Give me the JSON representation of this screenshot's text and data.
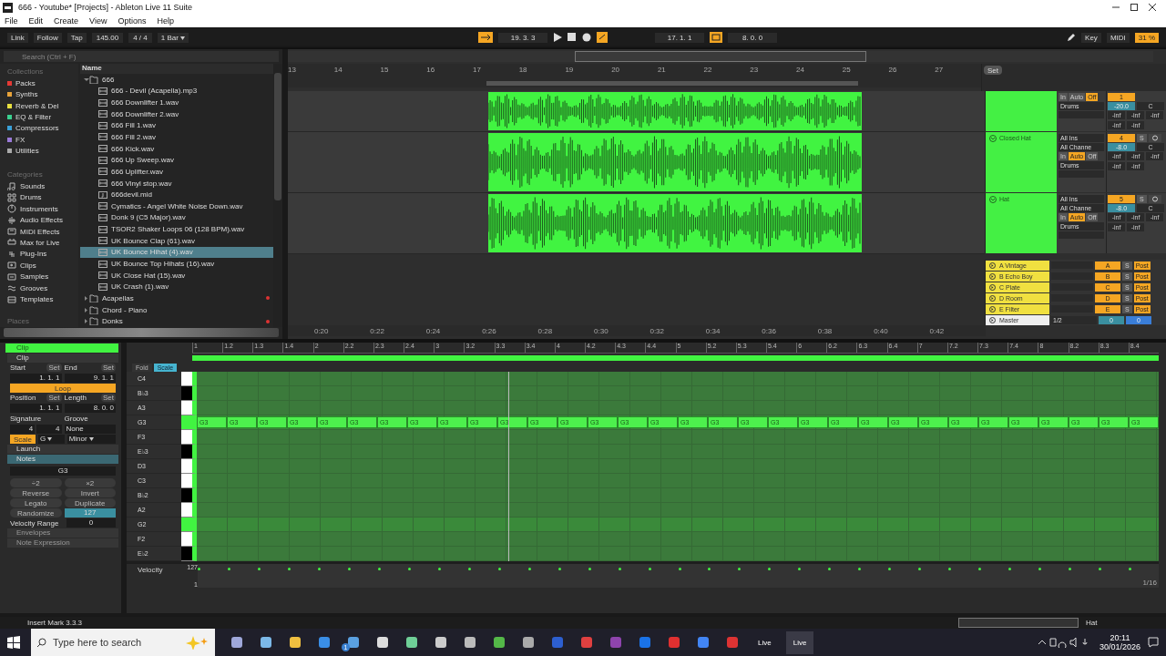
{
  "window": {
    "title": "666 - Youtube*  [Projects] - Ableton Live 11 Suite"
  },
  "menu": [
    "File",
    "Edit",
    "Create",
    "View",
    "Options",
    "Help"
  ],
  "transport": {
    "link": "Link",
    "follow": "Follow",
    "tap": "Tap",
    "tempo": "145.00",
    "signature": "4 / 4",
    "quantize": "1 Bar",
    "position": "19.  3.  3",
    "loop_start": "17.  1.  1",
    "loop_length": "8.  0.  0",
    "key": "Key",
    "midi": "MIDI",
    "cpu": "31 %"
  },
  "browser": {
    "search": {
      "placeholder": "Search (Ctrl + F)"
    },
    "collections_heading": "Collections",
    "collections": [
      {
        "label": "Packs",
        "color": "#e53935"
      },
      {
        "label": "Synths",
        "color": "#e8a33a"
      },
      {
        "label": "Reverb & Del",
        "color": "#e8e040"
      },
      {
        "label": "EQ & Filter",
        "color": "#3ad08f"
      },
      {
        "label": "Compressors",
        "color": "#3aa0d8"
      },
      {
        "label": "FX",
        "color": "#9a7ad8"
      },
      {
        "label": "Utilities",
        "color": "#aaaaaa"
      }
    ],
    "categories_heading": "Categories",
    "categories": [
      {
        "label": "Sounds",
        "kind": "sounds"
      },
      {
        "label": "Drums",
        "kind": "drums"
      },
      {
        "label": "Instruments",
        "kind": "instruments"
      },
      {
        "label": "Audio Effects",
        "kind": "audio"
      },
      {
        "label": "MIDI Effects",
        "kind": "midi"
      },
      {
        "label": "Max for Live",
        "kind": "max"
      },
      {
        "label": "Plug-Ins",
        "kind": "plugins"
      },
      {
        "label": "Clips",
        "kind": "clips"
      },
      {
        "label": "Samples",
        "kind": "samples"
      },
      {
        "label": "Grooves",
        "kind": "grooves"
      },
      {
        "label": "Templates",
        "kind": "templates"
      }
    ],
    "places_heading": "Places",
    "name_heading": "Name",
    "files": [
      {
        "label": "666",
        "kind": "folder",
        "expanded": true,
        "marked": false,
        "selected": false,
        "children": [
          {
            "label": "666 - Devil (Acapella).mp3",
            "kind": "audio",
            "selected": false
          },
          {
            "label": "666 Downlifter 1.wav",
            "kind": "audio",
            "selected": false
          },
          {
            "label": "666 Downlifter 2.wav",
            "kind": "audio",
            "selected": false
          },
          {
            "label": "666 Fill 1.wav",
            "kind": "audio",
            "selected": false
          },
          {
            "label": "666 Fill 2.wav",
            "kind": "audio",
            "selected": false
          },
          {
            "label": "666 Kick.wav",
            "kind": "audio",
            "selected": false
          },
          {
            "label": "666 Up Sweep.wav",
            "kind": "audio",
            "selected": false
          },
          {
            "label": "666 Uplifter.wav",
            "kind": "audio",
            "selected": false
          },
          {
            "label": "666 Vinyl stop.wav",
            "kind": "audio",
            "selected": false
          },
          {
            "label": "666devil.mid",
            "kind": "midi",
            "selected": false
          },
          {
            "label": "Cymatics - Angel White Noise Down.wav",
            "kind": "audio",
            "selected": false
          },
          {
            "label": "Donk 9 (C5 Major).wav",
            "kind": "audio",
            "selected": false
          },
          {
            "label": "TSOR2 Shaker Loops 06 (128 BPM).wav",
            "kind": "audio",
            "selected": false
          },
          {
            "label": "UK Bounce Clap (61).wav",
            "kind": "audio",
            "selected": false
          },
          {
            "label": "UK Bounce Hihat (4).wav",
            "kind": "audio",
            "selected": true
          },
          {
            "label": "UK Bounce Top Hihats (16).wav",
            "kind": "audio",
            "selected": false
          },
          {
            "label": "UK Close Hat (15).wav",
            "kind": "audio",
            "selected": false
          },
          {
            "label": "UK Crash (1).wav",
            "kind": "audio",
            "selected": false
          }
        ]
      },
      {
        "label": "Acapellas",
        "kind": "folder",
        "expanded": false,
        "marked": true,
        "selected": false
      },
      {
        "label": "Chord - Piano",
        "kind": "folder",
        "expanded": false,
        "marked": false,
        "selected": false
      },
      {
        "label": "Donks",
        "kind": "folder",
        "expanded": false,
        "marked": true,
        "selected": false
      }
    ]
  },
  "arrangement": {
    "bars": [
      "13",
      "14",
      "15",
      "16",
      "17",
      "18",
      "19",
      "20",
      "21",
      "22",
      "23",
      "24",
      "25",
      "26",
      "27"
    ],
    "times": [
      "0:20",
      "0:22",
      "0:24",
      "0:26",
      "0:28",
      "0:30",
      "0:32",
      "0:34",
      "0:36",
      "0:38",
      "0:40",
      "0:42"
    ]
  },
  "mixer": {
    "set": "Set",
    "tracks": [
      {
        "number": "1",
        "volume": "-20.0",
        "pan": "C",
        "monitor": [
          {
            "label": "In",
            "selected": false
          },
          {
            "label": "Auto",
            "selected": false
          },
          {
            "label": "Off",
            "selected": true
          }
        ],
        "output": "Drums",
        "meters": [
          "-inf",
          "-inf",
          "-inf",
          "-inf",
          "-inf"
        ]
      },
      {
        "name": "Closed Hat",
        "input": "All Ins",
        "channel": "All Channe",
        "number": "4",
        "solo": "S",
        "volume": "-8.0",
        "pan": "C",
        "monitor": [
          {
            "label": "In",
            "selected": false
          },
          {
            "label": "Auto",
            "selected": true
          },
          {
            "label": "Off",
            "selected": false
          }
        ],
        "output": "Drums",
        "meters": [
          "-inf",
          "-inf",
          "-inf",
          "-inf",
          "-inf"
        ]
      },
      {
        "name": "Hat",
        "input": "All Ins",
        "channel": "All Channe",
        "number": "5",
        "solo": "S",
        "volume": "-8.0",
        "pan": "C",
        "monitor": [
          {
            "label": "In",
            "selected": false
          },
          {
            "label": "Auto",
            "selected": true
          },
          {
            "label": "Off",
            "selected": false
          }
        ],
        "output": "Drums",
        "meters": [
          "-inf",
          "-inf",
          "-inf",
          "-inf",
          "-inf"
        ]
      }
    ],
    "returns": [
      {
        "name": "A Vintage",
        "letter": "A",
        "solo": "S",
        "mode": "Post"
      },
      {
        "name": "B Echo Boy",
        "letter": "B",
        "solo": "S",
        "mode": "Post"
      },
      {
        "name": "C Plate",
        "letter": "C",
        "solo": "S",
        "mode": "Post"
      },
      {
        "name": "D Room",
        "letter": "D",
        "solo": "S",
        "mode": "Post"
      },
      {
        "name": "E Filter",
        "letter": "E",
        "solo": "S",
        "mode": "Post"
      }
    ],
    "master": {
      "name": "Master",
      "routing": "1/2",
      "volume": "0",
      "pan": "0"
    }
  },
  "clip_panel": {
    "title": "Clip",
    "section": "Clip",
    "start": "Start",
    "end": "End",
    "set_start": "Set",
    "set_end": "Set",
    "set_position": "Set",
    "set_length": "Set",
    "start_value": "1.  1.  1",
    "end_value": "9.  1.  1",
    "loop": {
      "label": "Loop",
      "on": true
    },
    "position": "Position",
    "length": "Length",
    "position_value": "1.  1.  1",
    "length_value": "8.  0.  0",
    "signature": "Signature",
    "groove": "Groove",
    "sig_num": "4",
    "sig_den": "4",
    "groove_value": "None",
    "scale": {
      "label": "Scale",
      "on": true
    },
    "root": "G",
    "mode": "Minor",
    "launch": "Launch",
    "notes": "Notes",
    "note_value": "G3",
    "buttons": [
      "÷2",
      "×2",
      "Reverse",
      "Invert",
      "Legato",
      "Duplicate",
      "Randomize"
    ],
    "random_amount": "127",
    "velocity_range": "Velocity Range",
    "velocity_range_value": "0",
    "envelopes": "Envelopes",
    "note_expression": "Note Expression"
  },
  "piano_roll": {
    "fold": "Fold",
    "scale": {
      "label": "Scale",
      "selected": true
    },
    "ruler": [
      "1",
      "1.2",
      "1.3",
      "1.4",
      "2",
      "2.2",
      "2.3",
      "2.4",
      "3",
      "3.2",
      "3.3",
      "3.4",
      "4",
      "4.2",
      "4.3",
      "4.4",
      "5",
      "5.2",
      "5.3",
      "5.4",
      "6",
      "6.2",
      "6.3",
      "6.4",
      "7",
      "7.2",
      "7.3",
      "7.4",
      "8",
      "8.2",
      "8.3",
      "8.4"
    ],
    "keys": [
      {
        "label": "C4",
        "kind": "white"
      },
      {
        "label": "B♭3",
        "kind": "black"
      },
      {
        "label": "A3",
        "kind": "white"
      },
      {
        "label": "G3",
        "kind": "root",
        "notes": [
          {
            "label": "G3"
          },
          {
            "label": "G3"
          },
          {
            "label": "G3"
          },
          {
            "label": "G3"
          },
          {
            "label": "G3"
          },
          {
            "label": "G3"
          },
          {
            "label": "G3"
          },
          {
            "label": "G3"
          },
          {
            "label": "G3"
          },
          {
            "label": "G3"
          },
          {
            "label": "G3"
          },
          {
            "label": "G3"
          },
          {
            "label": "G3"
          },
          {
            "label": "G3"
          },
          {
            "label": "G3"
          },
          {
            "label": "G3"
          },
          {
            "label": "G3"
          },
          {
            "label": "G3"
          },
          {
            "label": "G3"
          },
          {
            "label": "G3"
          },
          {
            "label": "G3"
          },
          {
            "label": "G3"
          },
          {
            "label": "G3"
          },
          {
            "label": "G3"
          },
          {
            "label": "G3"
          },
          {
            "label": "G3"
          },
          {
            "label": "G3"
          },
          {
            "label": "G3"
          },
          {
            "label": "G3"
          },
          {
            "label": "G3"
          },
          {
            "label": "G3"
          },
          {
            "label": "G3"
          }
        ]
      },
      {
        "label": "F3",
        "kind": "white"
      },
      {
        "label": "E♭3",
        "kind": "black"
      },
      {
        "label": "D3",
        "kind": "white"
      },
      {
        "label": "C3",
        "kind": "white"
      },
      {
        "label": "B♭2",
        "kind": "black"
      },
      {
        "label": "A2",
        "kind": "white"
      },
      {
        "label": "G2",
        "kind": "root"
      },
      {
        "label": "F2",
        "kind": "white"
      },
      {
        "label": "E♭2",
        "kind": "black"
      }
    ],
    "velocity_label": "Velocity",
    "velocity_max": "127",
    "velocity_min": "1",
    "grid": "1/16"
  },
  "status_bar": {
    "message": "Insert Mark 3.3.3",
    "track": "Hat"
  },
  "taskbar": {
    "search_placeholder": "Type here to search",
    "mail_badge": "1",
    "tasks": [
      {
        "label": "Live",
        "selected": false
      },
      {
        "label": "Live",
        "selected": true
      }
    ],
    "time": "20:11",
    "date": "30/01/2026"
  }
}
